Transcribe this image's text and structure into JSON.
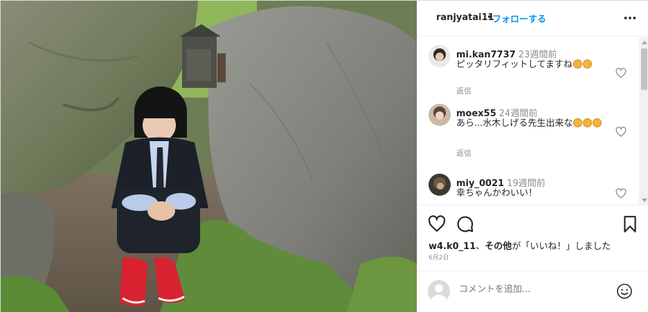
{
  "header": {
    "username": "ranjyatai11",
    "separator": "•",
    "follow_label": "フォローする",
    "more_icon": "more-horizontal-icon"
  },
  "comments": [
    {
      "username": "mi.kan7737",
      "time": "23週間前",
      "text": "ピッタリフィットしてますね",
      "emoji_count": 2,
      "reply_label": "返信"
    },
    {
      "username": "moex55",
      "time": "24週間前",
      "text": "あら...水木しげる先生出来な",
      "emoji_count": 3,
      "reply_label": "返信"
    },
    {
      "username": "miy_0021",
      "time": "19週間前",
      "text": "幸ちゃんかわいい！",
      "emoji_count": 0,
      "reply_label": ""
    }
  ],
  "actions": {
    "like_icon": "heart-icon",
    "comment_icon": "comment-icon",
    "save_icon": "bookmark-icon"
  },
  "likes": {
    "first_user": "w4.k0_11",
    "separator": "、",
    "others": "その他",
    "suffix": "が「いいね！」しました"
  },
  "date": "6月2日",
  "comment_box": {
    "placeholder": "コメントを追加...",
    "emoji_icon": "smiley-icon"
  },
  "colors": {
    "link": "#0095f6",
    "text": "#262626",
    "muted": "#8e8e8e",
    "border": "#efefef"
  }
}
